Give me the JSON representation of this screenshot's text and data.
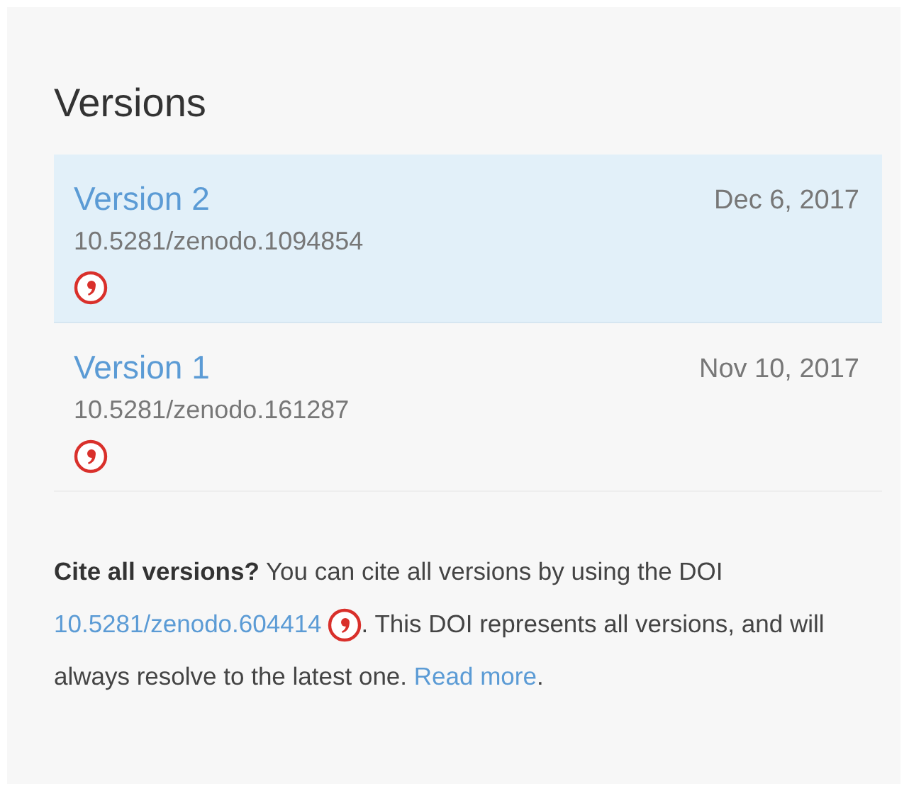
{
  "title": "Versions",
  "versions": [
    {
      "name": "Version 2",
      "date": "Dec 6, 2017",
      "doi": "10.5281/zenodo.1094854",
      "selected": true
    },
    {
      "name": "Version 1",
      "date": "Nov 10, 2017",
      "doi": "10.5281/zenodo.161287",
      "selected": false
    }
  ],
  "note": {
    "lead": "Cite all versions?",
    "text_before": "You can cite all versions by using the DOI",
    "doi_link": "10.5281/zenodo.604414",
    "text_after": ". This DOI represents all versions, and will always resolve to the latest one.",
    "read_more_link": "Read more",
    "end": "."
  }
}
